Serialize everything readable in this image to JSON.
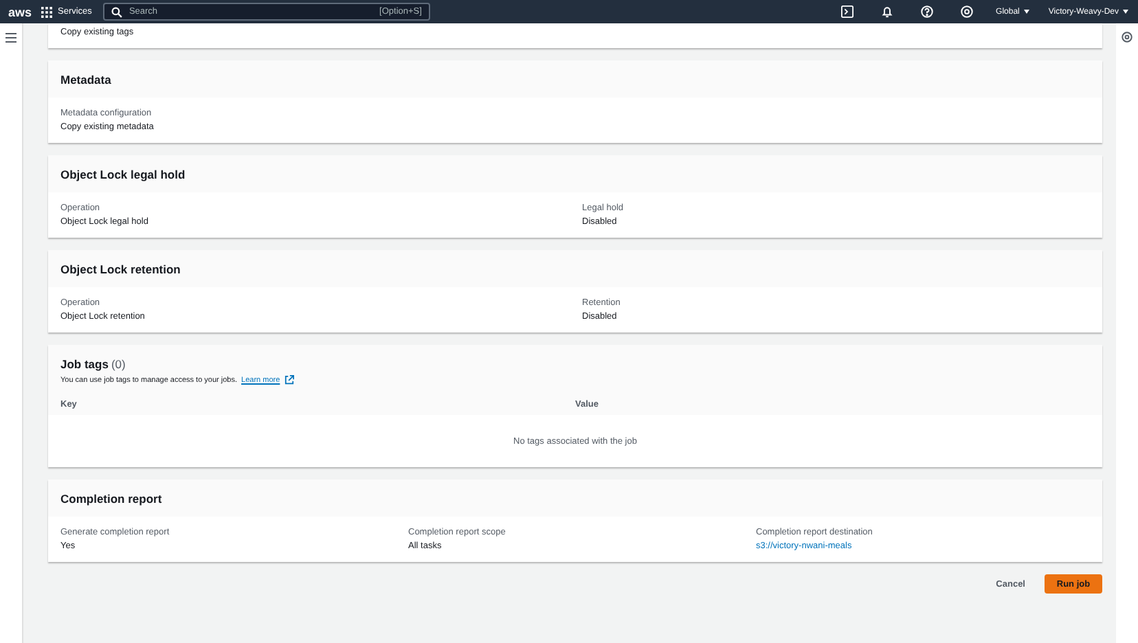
{
  "top_nav": {
    "logo": "aws",
    "services": "Services",
    "search": {
      "placeholder": "Search",
      "shortcut": "[Option+S]"
    },
    "region": "Global",
    "account": "Victory-Weavy-Dev"
  },
  "sections": [
    {
      "kind": "fields",
      "fields": [
        {
          "value": "Copy existing tags",
          "kind": "text"
        }
      ]
    },
    {
      "kind": "fields",
      "title": "Metadata",
      "fields": [
        {
          "label": "Metadata configuration",
          "value": "Copy existing metadata",
          "kind": "text"
        }
      ]
    },
    {
      "kind": "fields",
      "title": "Object Lock legal hold",
      "fields": [
        {
          "label": "Operation",
          "value": "Object Lock legal hold",
          "kind": "text"
        },
        {
          "label": "Legal hold",
          "value": "Disabled",
          "kind": "text"
        }
      ]
    },
    {
      "kind": "fields",
      "title": "Object Lock retention",
      "fields": [
        {
          "label": "Operation",
          "value": "Object Lock retention",
          "kind": "text"
        },
        {
          "label": "Retention",
          "value": "Disabled",
          "kind": "text"
        }
      ]
    },
    {
      "kind": "table",
      "title": "Job tags",
      "count": "(0)",
      "description": "You can use job tags to manage access to your jobs.",
      "link": "Learn more",
      "columns": [
        "Key",
        "Value"
      ],
      "empty": "No tags associated with the job"
    },
    {
      "kind": "fields",
      "title": "Completion report",
      "fields": [
        {
          "label": "Generate completion report",
          "value": "Yes",
          "kind": "text"
        },
        {
          "label": "Completion report scope",
          "value": "All tasks",
          "kind": "text"
        },
        {
          "label": "Completion report destination",
          "value": "s3://victory-nwani-meals",
          "kind": "link"
        }
      ]
    }
  ],
  "actions": {
    "cancel": "Cancel",
    "submit": "Run job"
  }
}
